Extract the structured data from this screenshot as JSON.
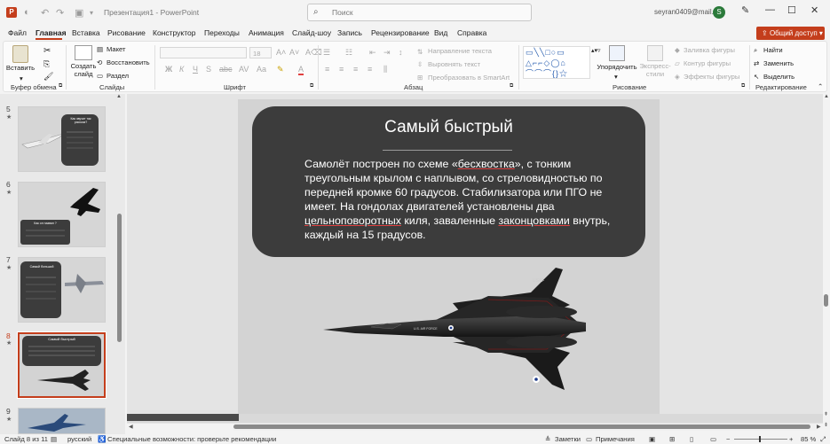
{
  "titlebar": {
    "title": "Презентация1 - PowerPoint",
    "search_placeholder": "Поиск",
    "user_email": "seyran0409@mail.ru",
    "avatar_letter": "S"
  },
  "tabs": [
    "Файл",
    "Главная",
    "Вставка",
    "Рисование",
    "Конструктор",
    "Переходы",
    "Анимация",
    "Слайд-шоу",
    "Запись",
    "Рецензирование",
    "Вид",
    "Справка"
  ],
  "share_label": "Общий доступ",
  "ribbon": {
    "groups": {
      "clipboard": "Буфер обмена",
      "slides": "Слайды",
      "font": "Шрифт",
      "paragraph": "Абзац",
      "drawing": "Рисование",
      "editing": "Редактирование"
    },
    "paste": "Вставить",
    "new_slide": "Создать слайд",
    "layout": "Макет",
    "reset": "Восстановить",
    "section": "Раздел",
    "font_size": "18",
    "text_direction": "Направление текста",
    "align_text": "Выровнять текст",
    "smartart": "Преобразовать в SmartArt",
    "arrange": "Упорядочить",
    "quick_styles": "Экспресс-стили",
    "shape_fill": "Заливка фигуры",
    "shape_outline": "Контур фигуры",
    "shape_effects": "Эффекты фигуры",
    "find": "Найти",
    "replace": "Заменить",
    "select": "Выделить"
  },
  "thumbnails": [
    {
      "num": "5",
      "text": "Как звучит так рассказ?"
    },
    {
      "num": "6",
      "text": "Как он назван ?"
    },
    {
      "num": "7",
      "text": "Самый большой"
    },
    {
      "num": "8",
      "text": "Самый быстрый"
    },
    {
      "num": "9",
      "text": ""
    }
  ],
  "slide": {
    "title": "Самый быстрый",
    "body_parts": [
      "Самолёт построен по схеме «",
      "бесхвостка",
      "», с тонким треугольным крылом с наплывом, со стреловидностью по передней кромке 60 градусов. Стабилизатора или ПГО не имеет. На гондолах двигателей установлены два ",
      "цельноповоротных",
      " киля, заваленные ",
      "законцовками",
      " внутрь, каждый на 15 градусов."
    ],
    "plane_markings": [
      "USAF",
      "U.S. AIR FORCE"
    ]
  },
  "status": {
    "slide_of": "Слайд 8 из 11",
    "language": "русский",
    "accessibility": "Специальные возможности: проверьте рекомендации",
    "notes": "Заметки",
    "comments": "Примечания",
    "zoom": "85 %"
  }
}
